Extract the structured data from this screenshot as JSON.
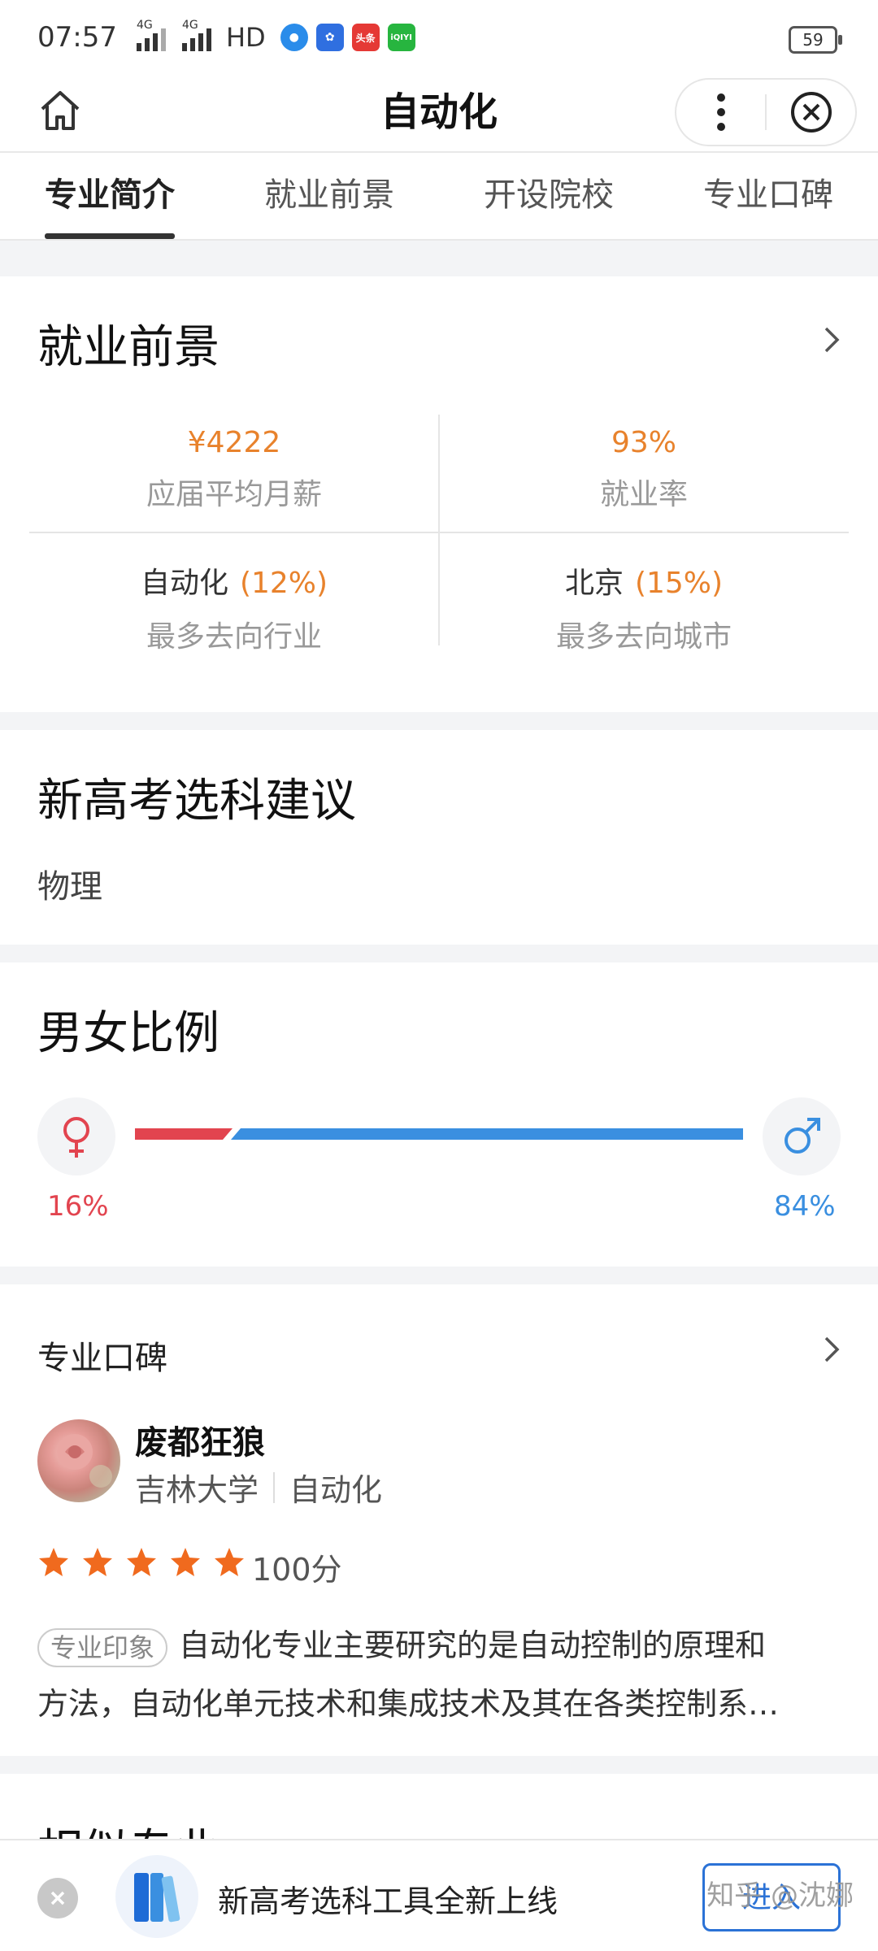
{
  "status_bar": {
    "time": "07:57",
    "signal1_label": "4G",
    "signal2_label": "4G",
    "hd": "HD",
    "app_icon_toutiao": "头条",
    "app_icon_iqiyi": "iQIYI",
    "battery": "59"
  },
  "nav": {
    "title": "自动化"
  },
  "tabs": [
    "专业简介",
    "就业前景",
    "开设院校",
    "专业口碑"
  ],
  "employment": {
    "title": "就业前景",
    "salary_value": "¥4222",
    "salary_label": "应届平均月薪",
    "rate_value": "93%",
    "rate_label": "就业率",
    "industry_name": "自动化",
    "industry_pct": "(12%)",
    "industry_label": "最多去向行业",
    "city_name": "北京",
    "city_pct": "(15%)",
    "city_label": "最多去向城市"
  },
  "subject": {
    "title": "新高考选科建议",
    "value": "物理"
  },
  "gender": {
    "title": "男女比例",
    "female_pct": "16%",
    "male_pct": "84%",
    "female_fraction": 0.16,
    "male_fraction": 0.84,
    "female_color": "#e2444f",
    "male_color": "#3a8fe0"
  },
  "review": {
    "title": "专业口碑",
    "user_name": "废都狂狼",
    "school": "吉林大学",
    "major": "自动化",
    "rating_stars": 5,
    "score": "100分",
    "tag": "专业印象",
    "text_line1": "自动化专业主要研究的是自动控制的原理和",
    "text_line2": "方法，自动化单元技术和集成技术及其在各类控制系…"
  },
  "next_section": {
    "title": "相似专业"
  },
  "bottom_bar": {
    "message": "新高考选科工具全新上线",
    "enter_label": "进入",
    "watermark": "知乎 @沈娜"
  }
}
